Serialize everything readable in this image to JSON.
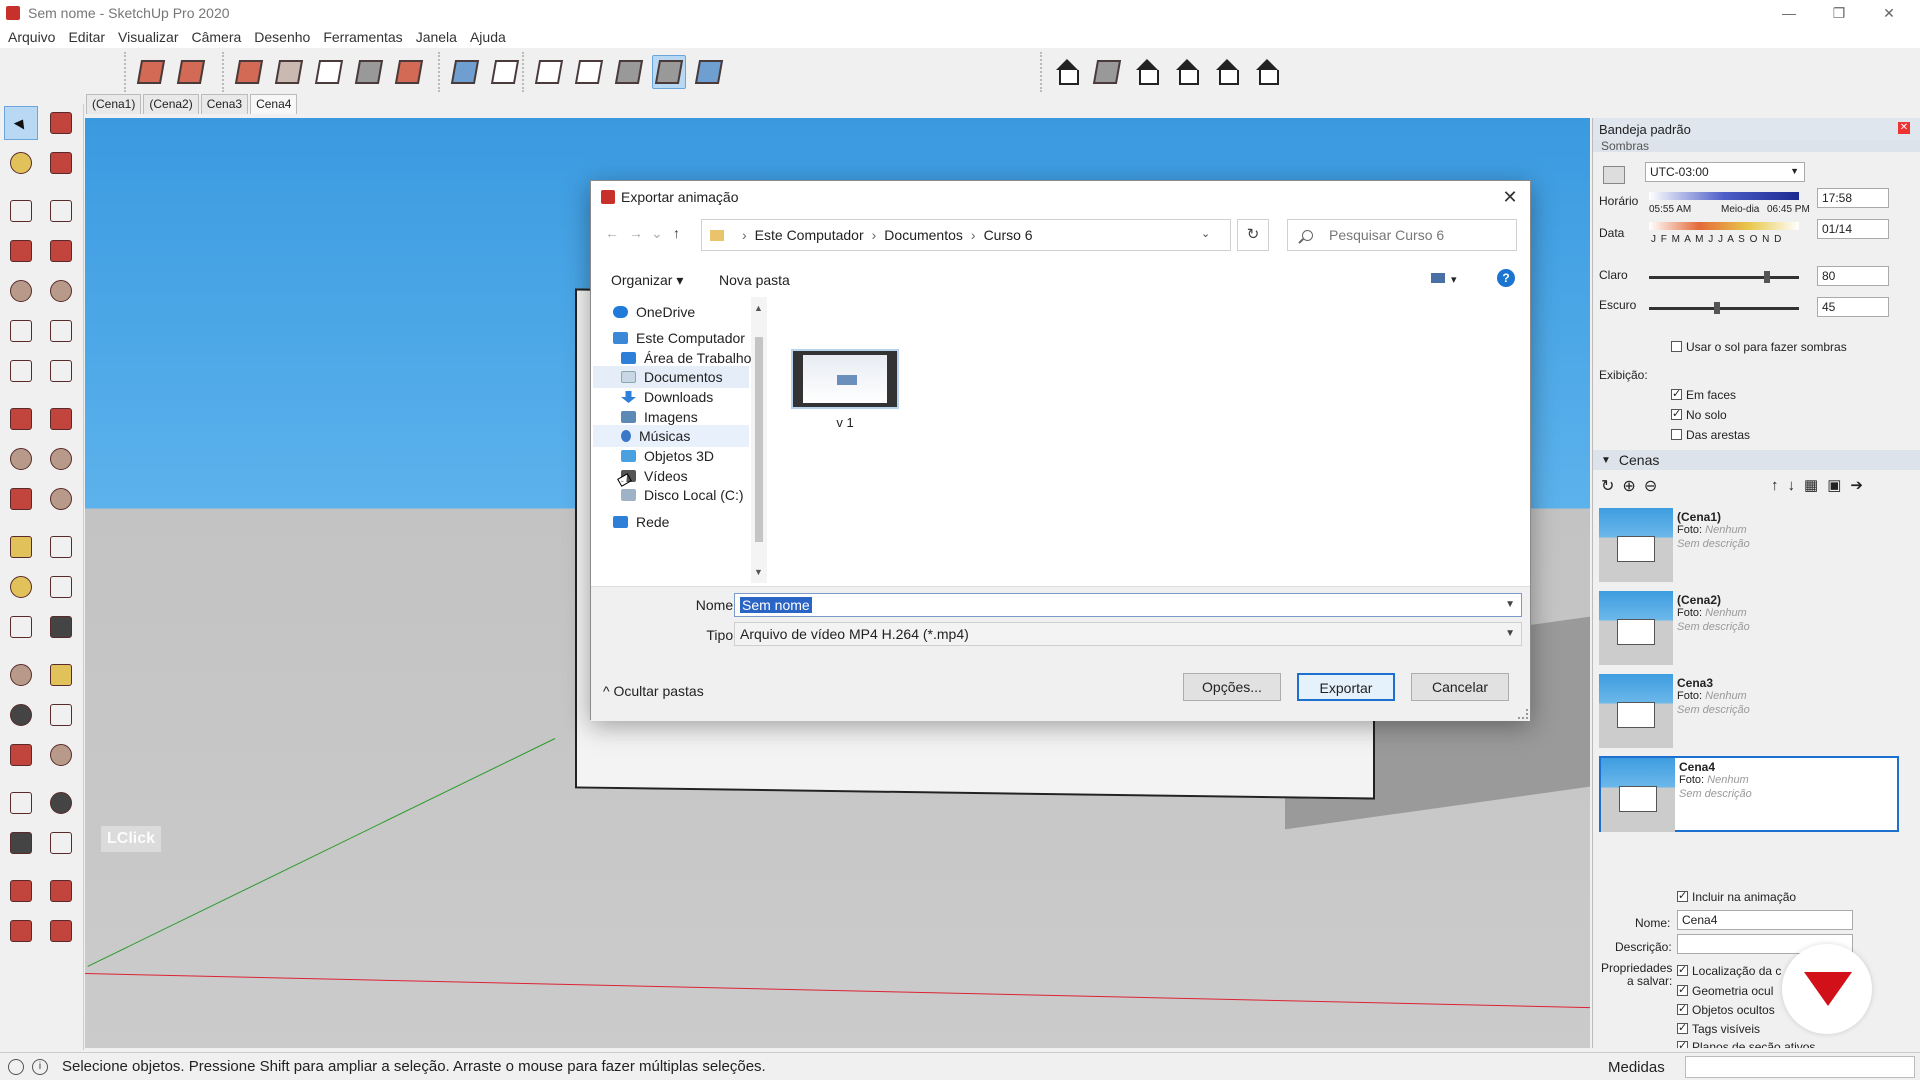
{
  "window": {
    "title": "Sem nome - SketchUp Pro 2020",
    "controls": [
      "—",
      "❐",
      "✕"
    ]
  },
  "menu": [
    "Arquivo",
    "Editar",
    "Visualizar",
    "Câmera",
    "Desenho",
    "Ferramentas",
    "Janela",
    "Ajuda"
  ],
  "scene_tabs": [
    "(Cena1)",
    "(Cena2)",
    "Cena3",
    "Cena4"
  ],
  "active_scene_tab": "Cena4",
  "viewport": {
    "watermark": "LClick"
  },
  "tray": {
    "title": "Bandeja padrão",
    "shadows": {
      "header": "Sombras",
      "timezone": "UTC-03:00",
      "time_label": "Horário",
      "time_start": "05:55 AM",
      "time_mid": "Meio-dia",
      "time_end": "06:45 PM",
      "time_value": "17:58",
      "date_label": "Data",
      "months": "J F M A M J J A S O N D",
      "date_value": "01/14",
      "light_label": "Claro",
      "light_value": "80",
      "light_level": 0.8,
      "dark_label": "Escuro",
      "dark_value": "45",
      "dark_level": 0.45,
      "use_sun": "Usar o sol para fazer sombras",
      "display_label": "Exibição:",
      "on_faces": "Em faces",
      "on_ground": "No solo",
      "from_edges": "Das arestas"
    },
    "scenes": {
      "header": "Cenas",
      "items": [
        {
          "name": "(Cena1)",
          "photo_label": "Foto:",
          "photo_value": "Nenhum",
          "desc": "Sem descrição"
        },
        {
          "name": "(Cena2)",
          "photo_label": "Foto:",
          "photo_value": "Nenhum",
          "desc": "Sem descrição"
        },
        {
          "name": "Cena3",
          "photo_label": "Foto:",
          "photo_value": "Nenhum",
          "desc": "Sem descrição"
        },
        {
          "name": "Cena4",
          "photo_label": "Foto:",
          "photo_value": "Nenhum",
          "desc": "Sem descrição"
        }
      ],
      "include_animation": "Incluir na animação",
      "name_label": "Nome:",
      "name_value": "Cena4",
      "desc_label": "Descrição:",
      "props_label_1": "Propriedades",
      "props_label_2": "a salvar:",
      "props": [
        "Localização da c",
        "Geometria ocul",
        "Objetos ocultos",
        "Tags visíveis",
        "Planos de seção ativos"
      ]
    }
  },
  "status": {
    "text": "Selecione objetos. Pressione Shift para ampliar a seleção. Arraste o mouse para fazer múltiplas seleções.",
    "measures_label": "Medidas",
    "info_icon": "i"
  },
  "dialog": {
    "title": "Exportar animação",
    "close": "✕",
    "back": "←",
    "forward": "→",
    "recent": "⌄",
    "up": "↑",
    "path": [
      "Este Computador",
      "Documentos",
      "Curso 6"
    ],
    "path_sep": "›",
    "dropdown": "⌄",
    "refresh": "↻",
    "search_placeholder": "Pesquisar Curso 6",
    "organize": "Organizar ▾",
    "new_folder": "Nova pasta",
    "view_caret": "▾",
    "help": "?",
    "nav": [
      {
        "label": "OneDrive",
        "icon": "cloud-icon"
      },
      {
        "label": "Este Computador",
        "icon": "computer-icon"
      },
      {
        "label": "Área de Trabalho",
        "icon": "desktop-icon"
      },
      {
        "label": "Documentos",
        "icon": "documents-icon"
      },
      {
        "label": "Downloads",
        "icon": "downloads-icon"
      },
      {
        "label": "Imagens",
        "icon": "pictures-icon"
      },
      {
        "label": "Músicas",
        "icon": "music-icon"
      },
      {
        "label": "Objetos 3D",
        "icon": "objects3d-icon"
      },
      {
        "label": "Vídeos",
        "icon": "videos-icon"
      },
      {
        "label": "Disco Local (C:)",
        "icon": "disk-icon"
      },
      {
        "label": "Rede",
        "icon": "network-icon"
      }
    ],
    "scroll_up": "▲",
    "scroll_down": "▼",
    "file": {
      "name": "v 1"
    },
    "name_label": "Nome:",
    "name_value": "Sem nome",
    "type_label": "Tipo:",
    "type_value": "Arquivo de vídeo MP4 H.264 (*.mp4)",
    "hide_folders": "^  Ocultar pastas",
    "options": "Opções...",
    "export": "Exportar",
    "cancel": "Cancelar"
  }
}
